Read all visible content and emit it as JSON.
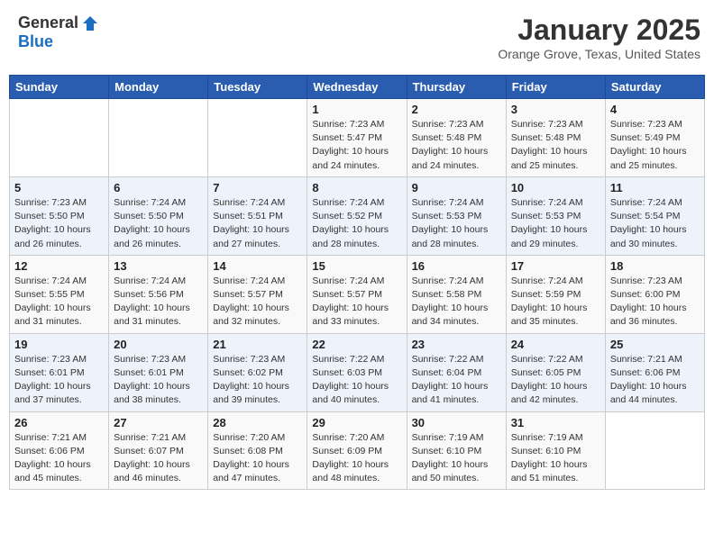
{
  "header": {
    "logo_general": "General",
    "logo_blue": "Blue",
    "month": "January 2025",
    "location": "Orange Grove, Texas, United States"
  },
  "weekdays": [
    "Sunday",
    "Monday",
    "Tuesday",
    "Wednesday",
    "Thursday",
    "Friday",
    "Saturday"
  ],
  "weeks": [
    [
      {
        "day": "",
        "info": ""
      },
      {
        "day": "",
        "info": ""
      },
      {
        "day": "",
        "info": ""
      },
      {
        "day": "1",
        "info": "Sunrise: 7:23 AM\nSunset: 5:47 PM\nDaylight: 10 hours\nand 24 minutes."
      },
      {
        "day": "2",
        "info": "Sunrise: 7:23 AM\nSunset: 5:48 PM\nDaylight: 10 hours\nand 24 minutes."
      },
      {
        "day": "3",
        "info": "Sunrise: 7:23 AM\nSunset: 5:48 PM\nDaylight: 10 hours\nand 25 minutes."
      },
      {
        "day": "4",
        "info": "Sunrise: 7:23 AM\nSunset: 5:49 PM\nDaylight: 10 hours\nand 25 minutes."
      }
    ],
    [
      {
        "day": "5",
        "info": "Sunrise: 7:23 AM\nSunset: 5:50 PM\nDaylight: 10 hours\nand 26 minutes."
      },
      {
        "day": "6",
        "info": "Sunrise: 7:24 AM\nSunset: 5:50 PM\nDaylight: 10 hours\nand 26 minutes."
      },
      {
        "day": "7",
        "info": "Sunrise: 7:24 AM\nSunset: 5:51 PM\nDaylight: 10 hours\nand 27 minutes."
      },
      {
        "day": "8",
        "info": "Sunrise: 7:24 AM\nSunset: 5:52 PM\nDaylight: 10 hours\nand 28 minutes."
      },
      {
        "day": "9",
        "info": "Sunrise: 7:24 AM\nSunset: 5:53 PM\nDaylight: 10 hours\nand 28 minutes."
      },
      {
        "day": "10",
        "info": "Sunrise: 7:24 AM\nSunset: 5:53 PM\nDaylight: 10 hours\nand 29 minutes."
      },
      {
        "day": "11",
        "info": "Sunrise: 7:24 AM\nSunset: 5:54 PM\nDaylight: 10 hours\nand 30 minutes."
      }
    ],
    [
      {
        "day": "12",
        "info": "Sunrise: 7:24 AM\nSunset: 5:55 PM\nDaylight: 10 hours\nand 31 minutes."
      },
      {
        "day": "13",
        "info": "Sunrise: 7:24 AM\nSunset: 5:56 PM\nDaylight: 10 hours\nand 31 minutes."
      },
      {
        "day": "14",
        "info": "Sunrise: 7:24 AM\nSunset: 5:57 PM\nDaylight: 10 hours\nand 32 minutes."
      },
      {
        "day": "15",
        "info": "Sunrise: 7:24 AM\nSunset: 5:57 PM\nDaylight: 10 hours\nand 33 minutes."
      },
      {
        "day": "16",
        "info": "Sunrise: 7:24 AM\nSunset: 5:58 PM\nDaylight: 10 hours\nand 34 minutes."
      },
      {
        "day": "17",
        "info": "Sunrise: 7:24 AM\nSunset: 5:59 PM\nDaylight: 10 hours\nand 35 minutes."
      },
      {
        "day": "18",
        "info": "Sunrise: 7:23 AM\nSunset: 6:00 PM\nDaylight: 10 hours\nand 36 minutes."
      }
    ],
    [
      {
        "day": "19",
        "info": "Sunrise: 7:23 AM\nSunset: 6:01 PM\nDaylight: 10 hours\nand 37 minutes."
      },
      {
        "day": "20",
        "info": "Sunrise: 7:23 AM\nSunset: 6:01 PM\nDaylight: 10 hours\nand 38 minutes."
      },
      {
        "day": "21",
        "info": "Sunrise: 7:23 AM\nSunset: 6:02 PM\nDaylight: 10 hours\nand 39 minutes."
      },
      {
        "day": "22",
        "info": "Sunrise: 7:22 AM\nSunset: 6:03 PM\nDaylight: 10 hours\nand 40 minutes."
      },
      {
        "day": "23",
        "info": "Sunrise: 7:22 AM\nSunset: 6:04 PM\nDaylight: 10 hours\nand 41 minutes."
      },
      {
        "day": "24",
        "info": "Sunrise: 7:22 AM\nSunset: 6:05 PM\nDaylight: 10 hours\nand 42 minutes."
      },
      {
        "day": "25",
        "info": "Sunrise: 7:21 AM\nSunset: 6:06 PM\nDaylight: 10 hours\nand 44 minutes."
      }
    ],
    [
      {
        "day": "26",
        "info": "Sunrise: 7:21 AM\nSunset: 6:06 PM\nDaylight: 10 hours\nand 45 minutes."
      },
      {
        "day": "27",
        "info": "Sunrise: 7:21 AM\nSunset: 6:07 PM\nDaylight: 10 hours\nand 46 minutes."
      },
      {
        "day": "28",
        "info": "Sunrise: 7:20 AM\nSunset: 6:08 PM\nDaylight: 10 hours\nand 47 minutes."
      },
      {
        "day": "29",
        "info": "Sunrise: 7:20 AM\nSunset: 6:09 PM\nDaylight: 10 hours\nand 48 minutes."
      },
      {
        "day": "30",
        "info": "Sunrise: 7:19 AM\nSunset: 6:10 PM\nDaylight: 10 hours\nand 50 minutes."
      },
      {
        "day": "31",
        "info": "Sunrise: 7:19 AM\nSunset: 6:10 PM\nDaylight: 10 hours\nand 51 minutes."
      },
      {
        "day": "",
        "info": ""
      }
    ]
  ]
}
